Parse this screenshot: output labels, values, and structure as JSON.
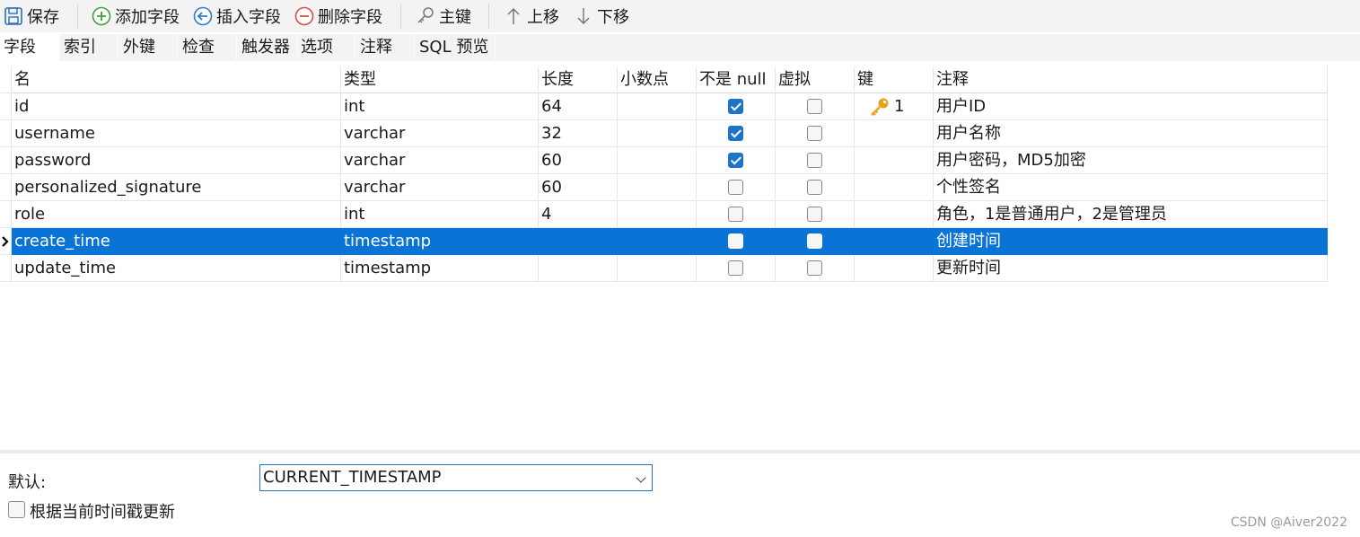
{
  "toolbar": {
    "save": "保存",
    "add_field": "添加字段",
    "insert_field": "插入字段",
    "delete_field": "删除字段",
    "primary_key": "主键",
    "move_up": "上移",
    "move_down": "下移"
  },
  "tabs": [
    "字段",
    "索引",
    "外键",
    "检查",
    "触发器",
    "选项",
    "注释",
    "SQL 预览"
  ],
  "columns": [
    "名",
    "类型",
    "长度",
    "小数点",
    "不是 null",
    "虚拟",
    "键",
    "注释"
  ],
  "rows": [
    {
      "name": "id",
      "type": "int",
      "length": "64",
      "decimals": "",
      "not_null": true,
      "virtual": false,
      "key": "1",
      "comment": "用户ID"
    },
    {
      "name": "username",
      "type": "varchar",
      "length": "32",
      "decimals": "",
      "not_null": true,
      "virtual": false,
      "key": "",
      "comment": "用户名称"
    },
    {
      "name": "password",
      "type": "varchar",
      "length": "60",
      "decimals": "",
      "not_null": true,
      "virtual": false,
      "key": "",
      "comment": "用户密码，MD5加密"
    },
    {
      "name": "personalized_signature",
      "type": "varchar",
      "length": "60",
      "decimals": "",
      "not_null": false,
      "virtual": false,
      "key": "",
      "comment": "个性签名"
    },
    {
      "name": "role",
      "type": "int",
      "length": "4",
      "decimals": "",
      "not_null": false,
      "virtual": false,
      "key": "",
      "comment": "角色，1是普通用户，2是管理员"
    },
    {
      "name": "create_time",
      "type": "timestamp",
      "length": "",
      "decimals": "",
      "not_null": false,
      "virtual": false,
      "key": "",
      "comment": "创建时间"
    },
    {
      "name": "update_time",
      "type": "timestamp",
      "length": "",
      "decimals": "",
      "not_null": false,
      "virtual": false,
      "key": "",
      "comment": "更新时间"
    }
  ],
  "selected_row": 5,
  "bottom": {
    "default_label": "默认:",
    "default_value": "CURRENT_TIMESTAMP",
    "update_on_time_label": "根据当前时间戳更新",
    "update_on_time_checked": false
  },
  "watermark": "CSDN @Aiver2022",
  "colors": {
    "selection": "#0a74d6",
    "checkbox_on": "#1f73c9",
    "add_icon": "#3aa335",
    "insert_icon": "#2a7cd0",
    "delete_icon": "#e04848",
    "key_icon": "#e8a316"
  }
}
